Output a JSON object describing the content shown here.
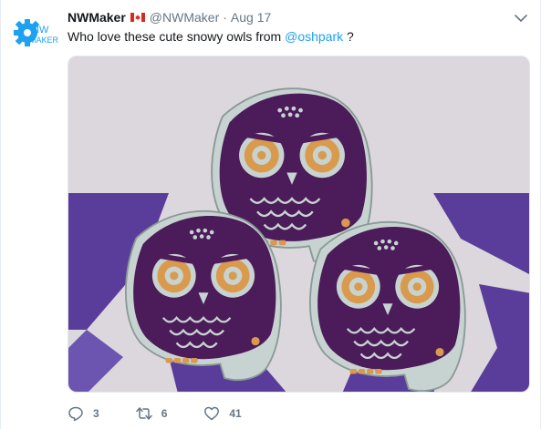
{
  "tweet": {
    "avatar": {
      "icon": "nw-maker-gear-logo",
      "line1": "NW",
      "line2": "MAKER",
      "color": "#1da1f2"
    },
    "author_name": "NWMaker",
    "flag_icon": "canada-flag-icon",
    "handle": "@NWMaker",
    "separator": "·",
    "time": "Aug 17",
    "text_before": "Who love these cute snowy owls from ",
    "mention": "@oshpark",
    "text_after": " ?",
    "media": {
      "kind": "photo",
      "subject": "three purple owl circuit boards",
      "accent": "#4a1a5e"
    },
    "actions": {
      "reply": {
        "icon": "reply-icon",
        "count": "3"
      },
      "retweet": {
        "icon": "retweet-icon",
        "count": "6"
      },
      "like": {
        "icon": "heart-icon",
        "count": "41"
      }
    },
    "menu_icon": "chevron-down-icon"
  }
}
